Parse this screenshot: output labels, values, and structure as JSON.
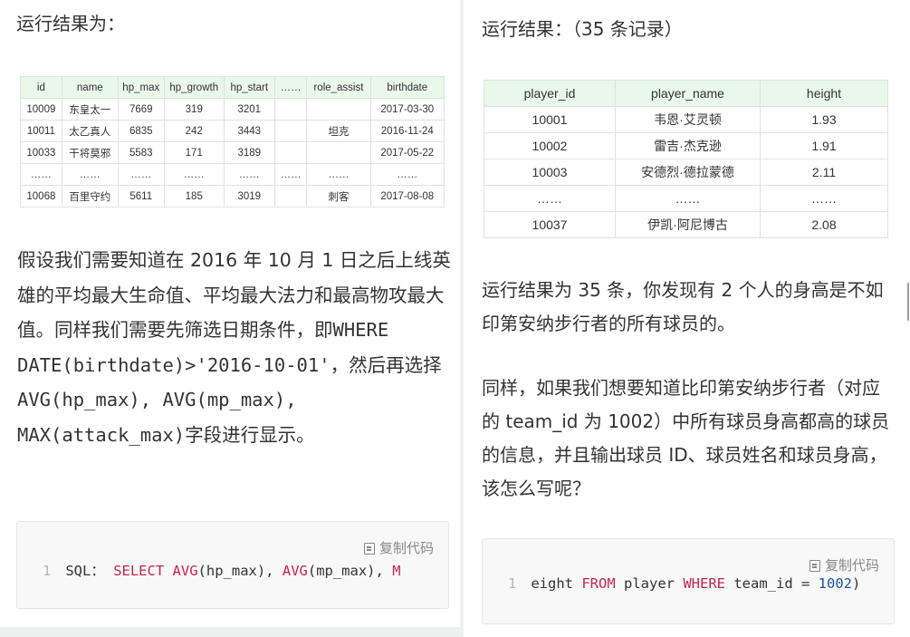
{
  "left": {
    "heading": "运行结果为：",
    "table": {
      "headers": [
        "id",
        "name",
        "hp_max",
        "hp_growth",
        "hp_start",
        "……",
        "role_assist",
        "birthdate"
      ],
      "rows": [
        [
          "10009",
          "东皇太一",
          "7669",
          "319",
          "3201",
          "",
          "",
          "2017-03-30"
        ],
        [
          "10011",
          "太乙真人",
          "6835",
          "242",
          "3443",
          "",
          "坦克",
          "2016-11-24"
        ],
        [
          "10033",
          "干将莫邪",
          "5583",
          "171",
          "3189",
          "",
          "",
          "2017-05-22"
        ],
        [
          "……",
          "……",
          "……",
          "……",
          "……",
          "……",
          "……",
          "……"
        ],
        [
          "10068",
          "百里守约",
          "5611",
          "185",
          "3019",
          "",
          "刺客",
          "2017-08-08"
        ]
      ]
    },
    "paragraph": {
      "part1": "假设我们需要知道在 2016 年 10 月 1 日之后上线英雄的平均最大生命值、平均最大法力和最高物攻最大值。同样我们需要先筛选日期条件，即",
      "code1": "WHERE DATE(birthdate)>'2016-10-01'",
      "part2": "，然后再选择",
      "code2": "AVG(hp_max), AVG(mp_max), MAX(attack_max)",
      "part3": "字段进行显示。"
    },
    "code_box": {
      "copy_label": "复制代码",
      "line_no": "1",
      "prefix": "SQL：",
      "keyword1": "SELECT",
      "func1": "AVG",
      "arg1": "(hp_max), ",
      "func2": "AVG",
      "arg2": "(mp_max), ",
      "tail": "M"
    }
  },
  "right": {
    "heading": "运行结果：（35 条记录）",
    "table": {
      "headers": [
        "player_id",
        "player_name",
        "height"
      ],
      "rows": [
        [
          "10001",
          "韦恩·艾灵顿",
          "1.93"
        ],
        [
          "10002",
          "雷吉·杰克逊",
          "1.91"
        ],
        [
          "10003",
          "安德烈·德拉蒙德",
          "2.11"
        ],
        [
          "……",
          "……",
          "……"
        ],
        [
          "10037",
          "伊凯·阿尼博古",
          "2.08"
        ]
      ]
    },
    "paragraph1": "运行结果为 35 条，你发现有 2 个人的身高是不如印第安纳步行者的所有球员的。",
    "paragraph2": "同样，如果我们想要知道比印第安纳步行者（对应的 team_id 为 1002）中所有球员身高都高的球员的信息，并且输出球员 ID、球员姓名和球员身高，该怎么写呢？",
    "code_box": {
      "copy_label": "复制代码",
      "line_no": "1",
      "t1": "eight ",
      "kw1": "FROM",
      "t2": " player ",
      "kw2": "WHERE",
      "t3": " team_id = ",
      "num": "1002",
      "t4": ")"
    }
  }
}
